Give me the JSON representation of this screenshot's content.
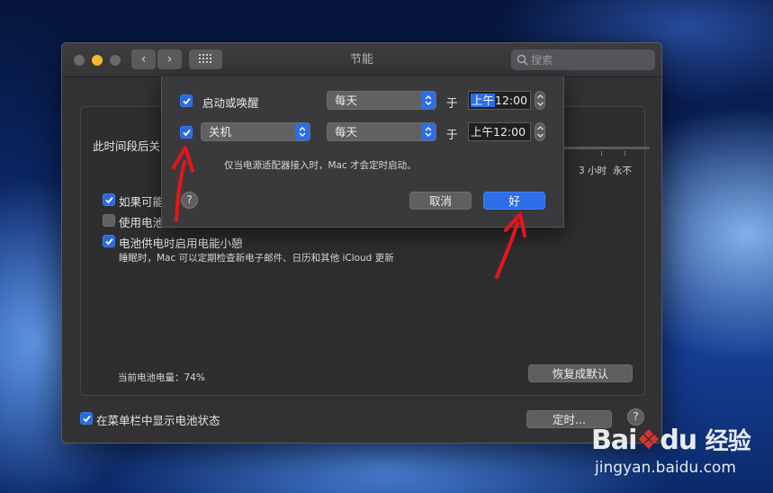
{
  "window": {
    "title": "节能",
    "search_placeholder": "搜索"
  },
  "panel": {
    "turn_off_label": "此时间段后关",
    "slider_ticks": [
      "3 小时",
      "永不"
    ],
    "options": [
      {
        "label": "如果可能",
        "checked": true
      },
      {
        "label": "使用电池",
        "checked": false
      },
      {
        "label": "电池供电时启用电能小憩",
        "checked": true
      }
    ],
    "power_nap_desc": "睡眠时，Mac 可以定期检查新电子邮件、日历和其他 iCloud 更新",
    "battery_level": "当前电池电量：74%",
    "restore_button": "恢复成默认",
    "show_battery_status": "在菜单栏中显示电池状态",
    "schedule_button": "定时...",
    "help": "?"
  },
  "sheet": {
    "row1": {
      "checked": true,
      "label": "启动或唤醒",
      "frequency": "每天",
      "at": "于",
      "time_period": "上午",
      "time": "12:00"
    },
    "row2": {
      "checked": true,
      "action": "关机",
      "frequency": "每天",
      "at": "于",
      "time_period": "上午",
      "time": "12:00"
    },
    "note": "仅当电源适配器接入时，Mac 才会定时启动。",
    "help": "?",
    "cancel_button": "取消",
    "ok_button": "好"
  },
  "watermark": {
    "brand": "Bai",
    "brand_suffix": "du",
    "brand_cn": "经验",
    "url": "jingyan.baidu.com"
  },
  "colors": {
    "accent": "#2b6ee8",
    "window_bg": "#323234",
    "annotation_arrow": "#e8141a"
  }
}
